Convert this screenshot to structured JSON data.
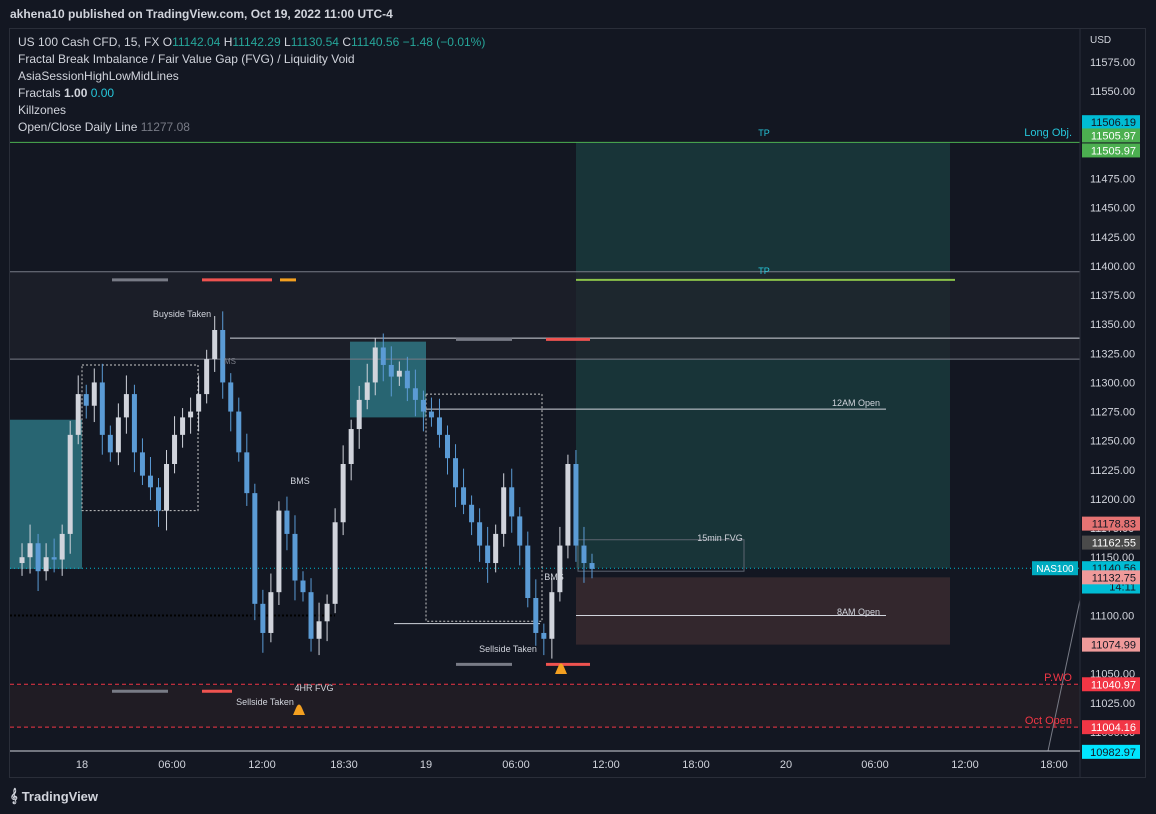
{
  "header": {
    "published": "akhena10 published on TradingView.com, Oct 19, 2022 11:00 UTC-4"
  },
  "legend": {
    "symbol": "US 100 Cash CFD, 15, FX",
    "o_label": "O",
    "o": "11142.04",
    "h_label": "H",
    "h": "11142.29",
    "l_label": "L",
    "l": "11130.54",
    "c_label": "C",
    "c": "11140.56",
    "change": "−1.48 (−0.01%)",
    "ind1": "Fractal Break Imbalance / Fair Value Gap (FVG) / Liquidity Void",
    "ind2": "AsiaSessionHighLowMidLines",
    "ind3_name": "Fractals",
    "ind3_v1": "1.00",
    "ind3_v2": "0.00",
    "ind4": "Killzones",
    "ind5_name": "Open/Close Daily Line",
    "ind5_v": "11277.08"
  },
  "footer": {
    "brand": "TradingView"
  },
  "colors": {
    "background": "#131722",
    "up": "#26a69a",
    "down": "#ef5350",
    "tp_zone": "#1e3d3e",
    "sl_zone": "#3a2a2e",
    "cyan": "#00bcd4"
  },
  "chart_data": {
    "type": "candlestick",
    "currency_label": "USD",
    "ylim": [
      10970,
      11600
    ],
    "y_ticks": [
      "11575.00",
      "11550.00",
      "11525.00",
      "11500.00",
      "11475.00",
      "11450.00",
      "11425.00",
      "11400.00",
      "11375.00",
      "11350.00",
      "11325.00",
      "11300.00",
      "11275.00",
      "11250.00",
      "11225.00",
      "11200.00",
      "11175.00",
      "11150.00",
      "11125.00",
      "11100.00",
      "11075.00",
      "11050.00",
      "11025.00",
      "11000.00"
    ],
    "x_ticks": [
      "18",
      "06:00",
      "12:00",
      "18:30",
      "19",
      "06:00",
      "12:00",
      "18:00",
      "20",
      "06:00",
      "12:00",
      "18:00"
    ],
    "price_tags": [
      {
        "label": "11506.19",
        "value": 11506.19,
        "bg": "#00bcd4",
        "fg": "#131722"
      },
      {
        "label": "11505.97",
        "value": 11505.97,
        "bg": "#4caf50",
        "fg": "#ffffff"
      },
      {
        "label": "11505.97",
        "value": 11505.97,
        "bg": "#4caf50",
        "fg": "#ffffff"
      },
      {
        "label": "11178.83",
        "value": 11178.83,
        "bg": "#e57373",
        "fg": "#131722"
      },
      {
        "label": "11162.55",
        "value": 11162.55,
        "bg": "#4a4a4a",
        "fg": "#ffffff"
      },
      {
        "label": "11140.56",
        "value": 11140.56,
        "bg": "#00bcd4",
        "fg": "#131722"
      },
      {
        "label": "14:11",
        "value": 11130.0,
        "bg": "#00bcd4",
        "fg": "#131722"
      },
      {
        "label": "11132.75",
        "value": 11132.75,
        "bg": "#ef9a9a",
        "fg": "#131722"
      },
      {
        "label": "11074.99",
        "value": 11074.99,
        "bg": "#ef9a9a",
        "fg": "#131722"
      },
      {
        "label": "11040.97",
        "value": 11040.97,
        "bg": "#f23645",
        "fg": "#ffffff"
      },
      {
        "label": "11004.16",
        "value": 11004.16,
        "bg": "#f23645",
        "fg": "#ffffff"
      },
      {
        "label": "10982.97",
        "value": 10982.97,
        "bg": "#00e5ff",
        "fg": "#131722"
      }
    ],
    "symbol_tag": "NAS100",
    "annotations": {
      "tp": "TP",
      "long_obj": "Long Obj.",
      "open_12am": "12AM Open",
      "open_8am": "8AM Open",
      "fvg_15": "15min FVG",
      "fvg_4h": "4HR FVG",
      "buyside": "Buyside Taken",
      "sellside": "Sellside Taken",
      "bms": "BMS",
      "pwo": "P.WO",
      "oct_open": "Oct Open",
      "ms": "MS"
    },
    "series": [
      {
        "name": "price",
        "values": [
          11145,
          11150,
          11162,
          11138,
          11150,
          11148,
          11170,
          11255,
          11290,
          11280,
          11300,
          11255,
          11240,
          11270,
          11290,
          11240,
          11220,
          11210,
          11190,
          11230,
          11255,
          11270,
          11275,
          11290,
          11320,
          11345,
          11300,
          11275,
          11240,
          11205,
          11110,
          11085,
          11120,
          11190,
          11170,
          11130,
          11120,
          11080,
          11095,
          11110,
          11180,
          11230,
          11260,
          11285,
          11300,
          11330,
          11315,
          11305,
          11310,
          11295,
          11285,
          11275,
          11270,
          11255,
          11235,
          11210,
          11195,
          11180,
          11160,
          11145,
          11170,
          11210,
          11185,
          11160,
          11115,
          11085,
          11080,
          11120,
          11160,
          11230,
          11160,
          11145,
          11140
        ]
      }
    ]
  }
}
